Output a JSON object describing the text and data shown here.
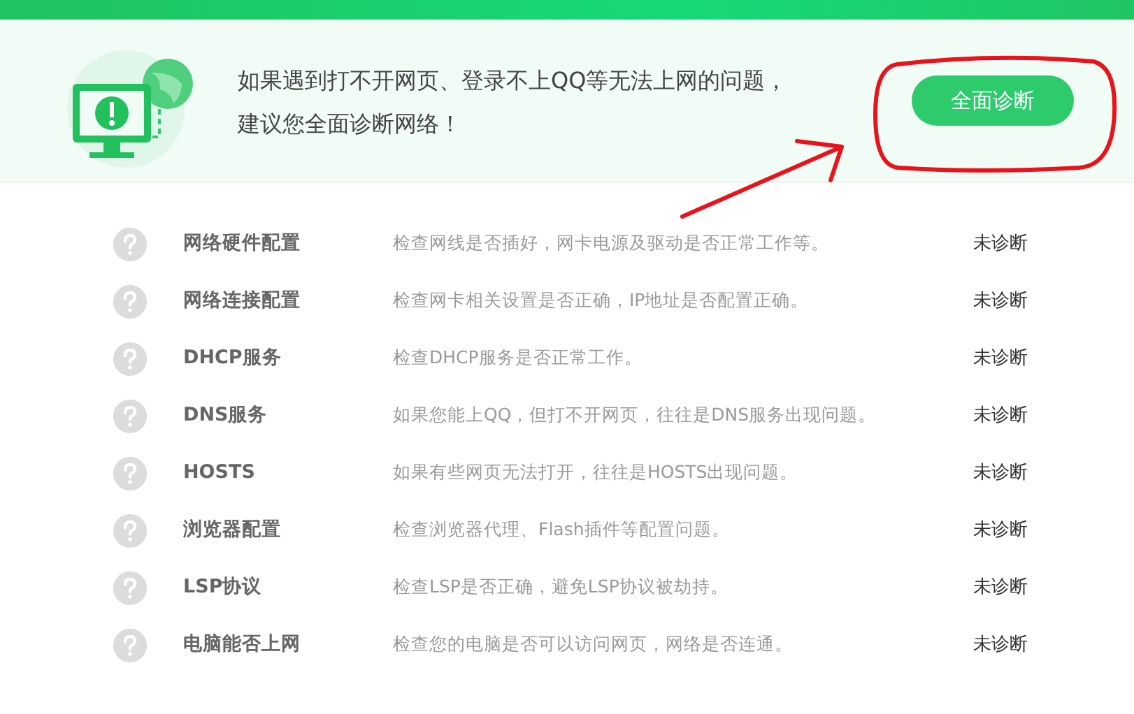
{
  "banner": {
    "message_lines": [
      "如果遇到打不开网页、登录不上QQ等无法上网的问题，",
      "建议您全面诊断网络！"
    ],
    "button": "全面诊断"
  },
  "checks": [
    {
      "name": "网络硬件配置",
      "description": "检查网线是否插好，网卡电源及驱动是否正常工作等。",
      "status": "未诊断"
    },
    {
      "name": "网络连接配置",
      "description": "检查网卡相关设置是否正确，IP地址是否配置正确。",
      "status": "未诊断"
    },
    {
      "name": "DHCP服务",
      "description": "检查DHCP服务是否正常工作。",
      "status": "未诊断"
    },
    {
      "name": "DNS服务",
      "description": "如果您能上QQ，但打不开网页，往往是DNS服务出现问题。",
      "status": "未诊断"
    },
    {
      "name": "HOSTS",
      "description": "如果有些网页无法打开，往往是HOSTS出现问题。",
      "status": "未诊断"
    },
    {
      "name": "浏览器配置",
      "description": "检查浏览器代理、Flash插件等配置问题。",
      "status": "未诊断"
    },
    {
      "name": "LSP协议",
      "description": "检查LSP是否正确，避免LSP协议被劫持。",
      "status": "未诊断"
    },
    {
      "name": "电脑能否上网",
      "description": "检查您的电脑是否可以访问网页，网络是否连通。",
      "status": "未诊断"
    }
  ]
}
